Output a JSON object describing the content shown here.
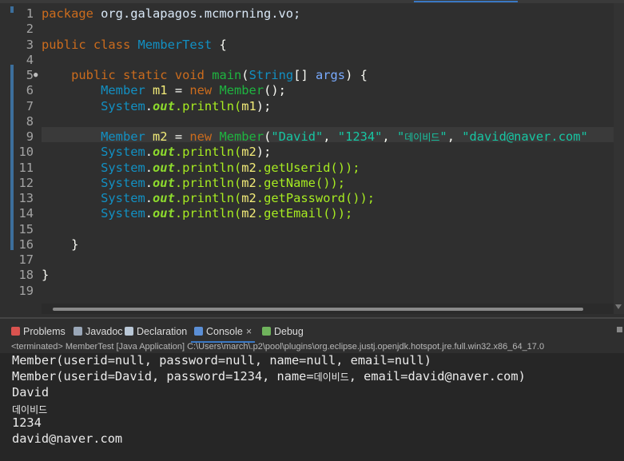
{
  "editor": {
    "lines": [
      {
        "n": "1",
        "tokens": [
          {
            "t": "package",
            "c": "k"
          },
          {
            "t": " org.galapagos.mcmorning.vo;",
            "c": "pkg"
          }
        ]
      },
      {
        "n": "2",
        "tokens": []
      },
      {
        "n": "3",
        "tokens": [
          {
            "t": "public",
            "c": "k"
          },
          {
            "t": " ",
            "c": "pkg"
          },
          {
            "t": "class",
            "c": "k"
          },
          {
            "t": " ",
            "c": "pkg"
          },
          {
            "t": "MemberTest",
            "c": "cls"
          },
          {
            "t": " {",
            "c": "br"
          }
        ]
      },
      {
        "n": "4",
        "tokens": []
      },
      {
        "n": "5",
        "marker": "●",
        "tokens": [
          {
            "t": "    ",
            "c": "pkg"
          },
          {
            "t": "public",
            "c": "k"
          },
          {
            "t": " ",
            "c": "pkg"
          },
          {
            "t": "static",
            "c": "k"
          },
          {
            "t": " ",
            "c": "pkg"
          },
          {
            "t": "void",
            "c": "k"
          },
          {
            "t": " ",
            "c": "pkg"
          },
          {
            "t": "main",
            "c": "fn"
          },
          {
            "t": "(",
            "c": "br"
          },
          {
            "t": "String",
            "c": "cls"
          },
          {
            "t": "[] ",
            "c": "br"
          },
          {
            "t": "args",
            "c": "pm"
          },
          {
            "t": ") {",
            "c": "br"
          }
        ]
      },
      {
        "n": "6",
        "tokens": [
          {
            "t": "        ",
            "c": "pkg"
          },
          {
            "t": "Member",
            "c": "cls"
          },
          {
            "t": " ",
            "c": "pkg"
          },
          {
            "t": "m1",
            "c": "var"
          },
          {
            "t": " = ",
            "c": "br"
          },
          {
            "t": "new",
            "c": "k"
          },
          {
            "t": " ",
            "c": "pkg"
          },
          {
            "t": "Member",
            "c": "fn"
          },
          {
            "t": "();",
            "c": "br"
          }
        ]
      },
      {
        "n": "7",
        "tokens": [
          {
            "t": "        ",
            "c": "pkg"
          },
          {
            "t": "System",
            "c": "cls"
          },
          {
            "t": ".",
            "c": "br"
          },
          {
            "t": "out",
            "c": "fld"
          },
          {
            "t": ".println(",
            "c": "mth"
          },
          {
            "t": "m1",
            "c": "var"
          },
          {
            "t": ");",
            "c": "br"
          }
        ]
      },
      {
        "n": "8",
        "tokens": []
      },
      {
        "n": "9",
        "tokens": [
          {
            "t": "        ",
            "c": "pkg"
          },
          {
            "t": "Member",
            "c": "cls"
          },
          {
            "t": " ",
            "c": "pkg"
          },
          {
            "t": "m2",
            "c": "var"
          },
          {
            "t": " = ",
            "c": "br"
          },
          {
            "t": "new",
            "c": "k"
          },
          {
            "t": " ",
            "c": "pkg"
          },
          {
            "t": "Member",
            "c": "fn"
          },
          {
            "t": "(",
            "c": "br"
          },
          {
            "t": "\"David\"",
            "c": "st"
          },
          {
            "t": ", ",
            "c": "br"
          },
          {
            "t": "\"1234\"",
            "c": "st"
          },
          {
            "t": ", ",
            "c": "br"
          },
          {
            "t": "\"",
            "c": "st"
          },
          {
            "t": "데이비드",
            "c": "st ko"
          },
          {
            "t": "\"",
            "c": "st"
          },
          {
            "t": ", ",
            "c": "br"
          },
          {
            "t": "\"david@naver.com\"",
            "c": "st"
          }
        ]
      },
      {
        "n": "10",
        "tokens": [
          {
            "t": "        ",
            "c": "pkg"
          },
          {
            "t": "System",
            "c": "cls"
          },
          {
            "t": ".",
            "c": "br"
          },
          {
            "t": "out",
            "c": "fld"
          },
          {
            "t": ".println(",
            "c": "mth"
          },
          {
            "t": "m2",
            "c": "var"
          },
          {
            "t": ");",
            "c": "br"
          }
        ]
      },
      {
        "n": "11",
        "tokens": [
          {
            "t": "        ",
            "c": "pkg"
          },
          {
            "t": "System",
            "c": "cls"
          },
          {
            "t": ".",
            "c": "br"
          },
          {
            "t": "out",
            "c": "fld"
          },
          {
            "t": ".println(",
            "c": "mth"
          },
          {
            "t": "m2",
            "c": "var"
          },
          {
            "t": ".getUserid());",
            "c": "mth"
          }
        ]
      },
      {
        "n": "12",
        "tokens": [
          {
            "t": "        ",
            "c": "pkg"
          },
          {
            "t": "System",
            "c": "cls"
          },
          {
            "t": ".",
            "c": "br"
          },
          {
            "t": "out",
            "c": "fld"
          },
          {
            "t": ".println(",
            "c": "mth"
          },
          {
            "t": "m2",
            "c": "var"
          },
          {
            "t": ".getName());",
            "c": "mth"
          }
        ]
      },
      {
        "n": "13",
        "tokens": [
          {
            "t": "        ",
            "c": "pkg"
          },
          {
            "t": "System",
            "c": "cls"
          },
          {
            "t": ".",
            "c": "br"
          },
          {
            "t": "out",
            "c": "fld"
          },
          {
            "t": ".println(",
            "c": "mth"
          },
          {
            "t": "m2",
            "c": "var"
          },
          {
            "t": ".getPassword());",
            "c": "mth"
          }
        ]
      },
      {
        "n": "14",
        "tokens": [
          {
            "t": "        ",
            "c": "pkg"
          },
          {
            "t": "System",
            "c": "cls"
          },
          {
            "t": ".",
            "c": "br"
          },
          {
            "t": "out",
            "c": "fld"
          },
          {
            "t": ".println(",
            "c": "mth"
          },
          {
            "t": "m2",
            "c": "var"
          },
          {
            "t": ".getEmail());",
            "c": "mth"
          }
        ]
      },
      {
        "n": "15",
        "tokens": []
      },
      {
        "n": "16",
        "tokens": [
          {
            "t": "    }",
            "c": "br"
          }
        ]
      },
      {
        "n": "17",
        "tokens": []
      },
      {
        "n": "18",
        "tokens": [
          {
            "t": "}",
            "c": "br"
          }
        ]
      },
      {
        "n": "19",
        "tokens": []
      }
    ]
  },
  "views": {
    "tabs": [
      {
        "label": "Problems",
        "icon": "problems-icon",
        "color": "#d9534f"
      },
      {
        "label": "Javadoc",
        "icon": "javadoc-icon",
        "color": "#9aa7b8"
      },
      {
        "label": "Declaration",
        "icon": "declaration-icon",
        "color": "#b9c7d6"
      },
      {
        "label": "Console",
        "icon": "console-icon",
        "color": "#5b8fd6",
        "active": true,
        "close": "×"
      },
      {
        "label": "Debug",
        "icon": "debug-icon",
        "color": "#6fb35c"
      }
    ]
  },
  "console": {
    "status": "<terminated> MemberTest [Java Application] C:\\Users\\march\\.p2\\pool\\plugins\\org.eclipse.justj.openjdk.hotspot.jre.full.win32.x86_64_17.0",
    "lines": [
      {
        "parts": [
          {
            "t": "Member(userid=null, password=null, name=null, email=null)"
          }
        ]
      },
      {
        "parts": [
          {
            "t": "Member(userid=David, password=1234, name="
          },
          {
            "t": "데이비드",
            "ko": true
          },
          {
            "t": ", email=david@naver.com)"
          }
        ]
      },
      {
        "parts": [
          {
            "t": "David"
          }
        ]
      },
      {
        "parts": [
          {
            "t": "데이비드",
            "ko": true
          }
        ]
      },
      {
        "parts": [
          {
            "t": "1234"
          }
        ]
      },
      {
        "parts": [
          {
            "t": "david@naver.com"
          }
        ]
      }
    ]
  }
}
